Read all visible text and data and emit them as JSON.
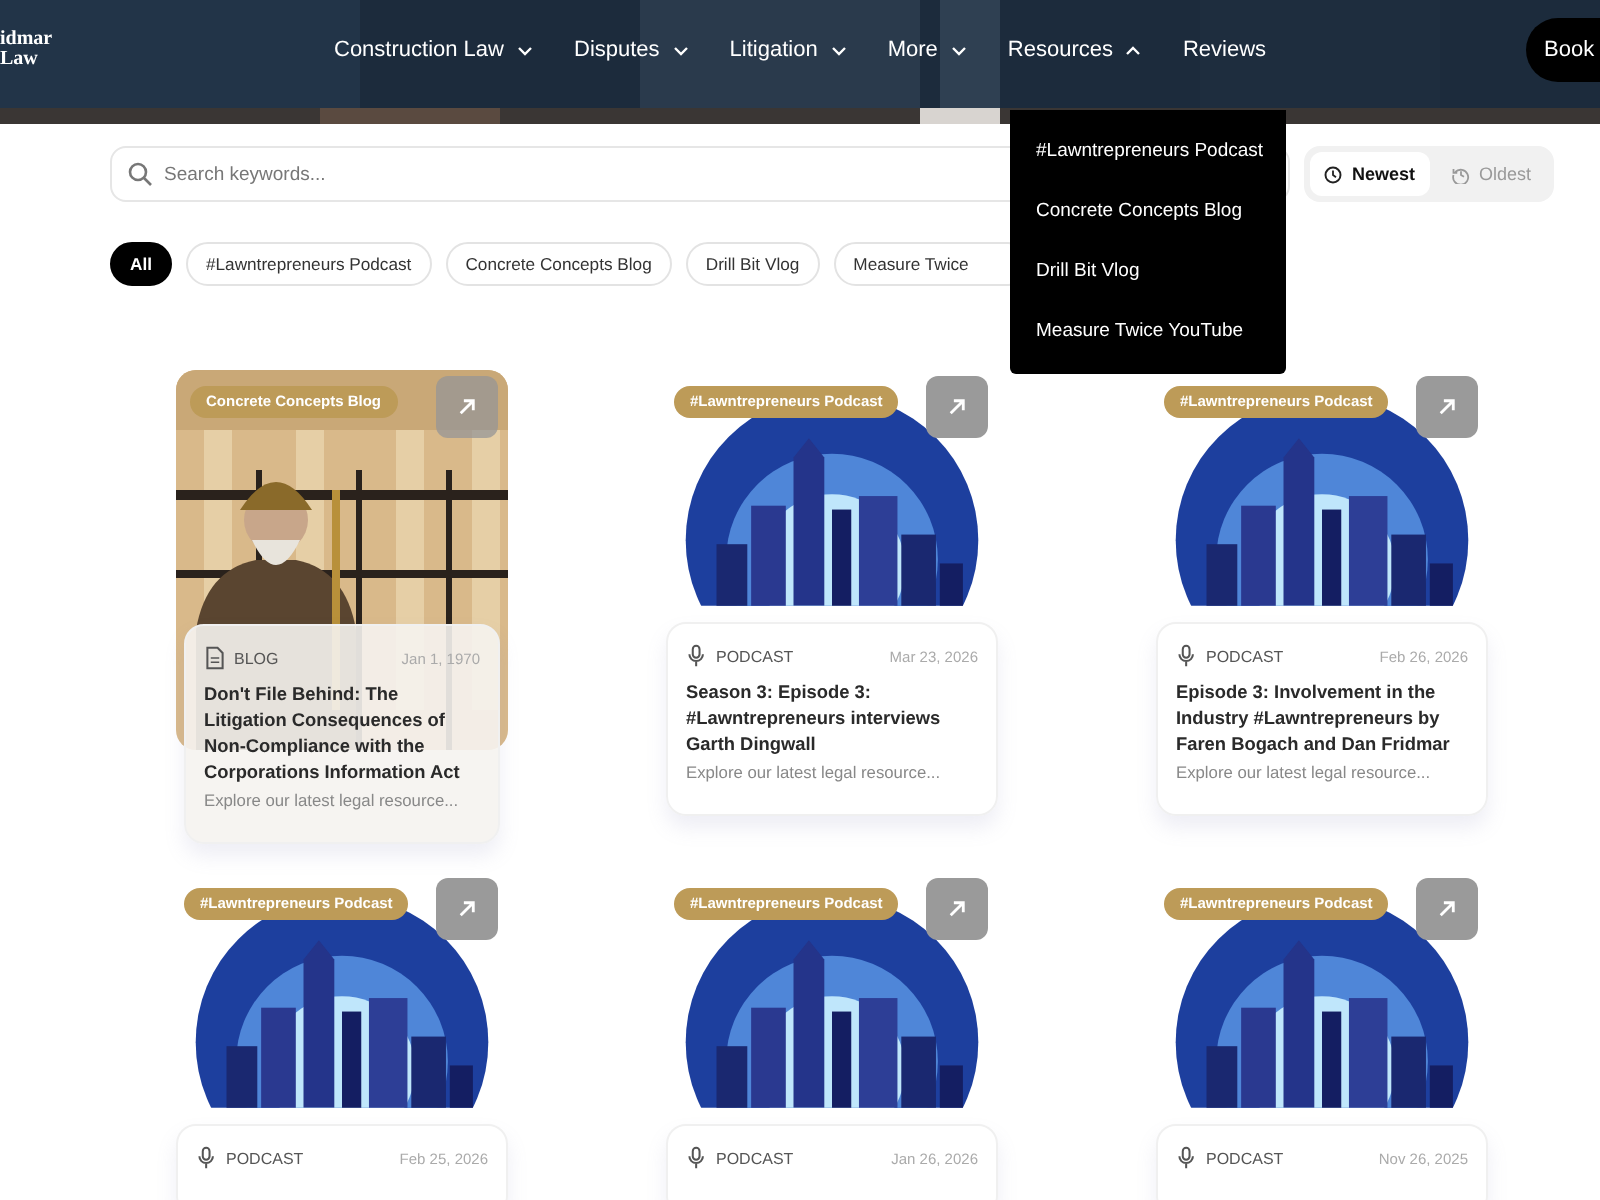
{
  "header": {
    "logo": [
      "idmar",
      "Law"
    ],
    "nav": [
      {
        "label": "Construction Law",
        "expanded": false
      },
      {
        "label": "Disputes",
        "expanded": false
      },
      {
        "label": "Litigation",
        "expanded": false
      },
      {
        "label": "More",
        "expanded": false
      },
      {
        "label": "Resources",
        "expanded": true
      },
      {
        "label": "Reviews"
      }
    ],
    "book_button": "Book"
  },
  "dropdown": {
    "items": [
      "#Lawntrepreneurs Podcast",
      "Concrete Concepts Blog",
      "Drill Bit Vlog",
      "Measure Twice YouTube"
    ]
  },
  "search": {
    "placeholder": "Search keywords..."
  },
  "sort": [
    {
      "label": "Newest",
      "kind": "clock",
      "selected": true
    },
    {
      "label": "Oldest",
      "kind": "history",
      "selected": false
    }
  ],
  "filters": [
    {
      "label": "All",
      "selected": true
    },
    {
      "label": "#Lawntrepreneurs Podcast",
      "selected": false
    },
    {
      "label": "Concrete Concepts Blog",
      "selected": false
    },
    {
      "label": "Drill Bit Vlog",
      "selected": false
    },
    {
      "label": "Measure Twice",
      "selected": false
    }
  ],
  "cards": [
    {
      "tag": "Concrete Concepts Blog",
      "type": {
        "kind": "blog",
        "label": "BLOG"
      },
      "date": "Jan 1, 1970",
      "title": "Don't File Behind: The Litigation Consequences of Non-Compliance with the Corporations Information Act",
      "excerpt": "Explore our latest legal resource..."
    },
    {
      "image": {
        "kind": "skyline"
      },
      "tag": "#Lawntrepreneurs Podcast",
      "type": {
        "kind": "podcast",
        "label": "PODCAST"
      },
      "date": "Mar 23, 2026",
      "title": "Season 3: Episode 3: #Lawntrepreneurs interviews Garth Dingwall",
      "excerpt": "Explore our latest legal resource..."
    },
    {
      "image": {
        "kind": "skyline"
      },
      "tag": "#Lawntrepreneurs Podcast",
      "type": {
        "kind": "podcast",
        "label": "PODCAST"
      },
      "date": "Feb 26, 2026",
      "title": "Episode 3: Involvement in the Industry #Lawntrepreneurs by Faren Bogach and Dan Fridmar",
      "excerpt": "Explore our latest legal resource..."
    },
    {
      "image": {
        "kind": "skyline"
      },
      "tag": "#Lawntrepreneurs Podcast",
      "type": {
        "kind": "podcast",
        "label": "PODCAST"
      },
      "date": "Feb 25, 2026"
    },
    {
      "image": {
        "kind": "skyline"
      },
      "tag": "#Lawntrepreneurs Podcast",
      "type": {
        "kind": "podcast",
        "label": "PODCAST"
      },
      "date": "Jan 26, 2026"
    },
    {
      "image": {
        "kind": "skyline"
      },
      "tag": "#Lawntrepreneurs Podcast",
      "type": {
        "kind": "podcast",
        "label": "PODCAST"
      },
      "date": "Nov 26, 2025"
    }
  ]
}
